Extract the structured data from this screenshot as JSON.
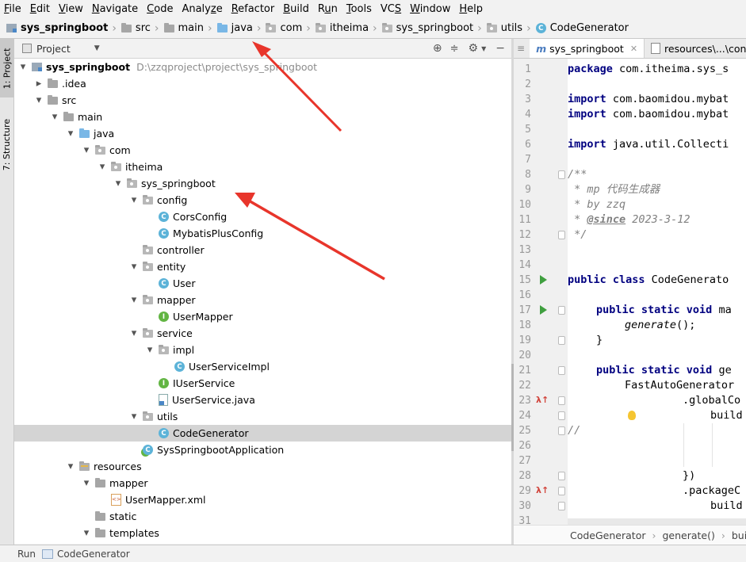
{
  "menubar": [
    "File",
    "Edit",
    "View",
    "Navigate",
    "Code",
    "Analyze",
    "Refactor",
    "Build",
    "Run",
    "Tools",
    "VCS",
    "Window",
    "Help"
  ],
  "menubar_mnemonics": [
    "F",
    "E",
    "V",
    "N",
    "C",
    "z",
    "R",
    "B",
    "u",
    "T",
    "S",
    "W",
    "H"
  ],
  "breadcrumb": [
    "sys_springboot",
    "src",
    "main",
    "java",
    "com",
    "itheima",
    "sys_springboot",
    "utils",
    "CodeGenerator"
  ],
  "left_tool_tabs": [
    "1: Project",
    "7: Structure"
  ],
  "project_panel": {
    "title": "Project"
  },
  "tree": [
    {
      "label": "sys_springboot",
      "path": "D:\\zzqproject\\project\\sys_springboot",
      "depth": 0,
      "arrow": "down",
      "icon": "module-icon",
      "bold": true
    },
    {
      "label": ".idea",
      "depth": 1,
      "arrow": "right",
      "icon": "folder-icon"
    },
    {
      "label": "src",
      "depth": 1,
      "arrow": "down",
      "icon": "folder-icon"
    },
    {
      "label": "main",
      "depth": 2,
      "arrow": "down",
      "icon": "folder-icon"
    },
    {
      "label": "java",
      "depth": 3,
      "arrow": "down",
      "icon": "source-folder-icon"
    },
    {
      "label": "com",
      "depth": 4,
      "arrow": "down",
      "icon": "package-icon"
    },
    {
      "label": "itheima",
      "depth": 5,
      "arrow": "down",
      "icon": "package-icon"
    },
    {
      "label": "sys_springboot",
      "depth": 6,
      "arrow": "down",
      "icon": "package-icon"
    },
    {
      "label": "config",
      "depth": 7,
      "arrow": "down",
      "icon": "package-icon"
    },
    {
      "label": "CorsConfig",
      "depth": 8,
      "arrow": "",
      "icon": "class-icon"
    },
    {
      "label": "MybatisPlusConfig",
      "depth": 8,
      "arrow": "",
      "icon": "class-icon"
    },
    {
      "label": "controller",
      "depth": 7,
      "arrow": "",
      "icon": "package-icon"
    },
    {
      "label": "entity",
      "depth": 7,
      "arrow": "down",
      "icon": "package-icon"
    },
    {
      "label": "User",
      "depth": 8,
      "arrow": "",
      "icon": "class-icon"
    },
    {
      "label": "mapper",
      "depth": 7,
      "arrow": "down",
      "icon": "package-icon"
    },
    {
      "label": "UserMapper",
      "depth": 8,
      "arrow": "",
      "icon": "interface-icon"
    },
    {
      "label": "service",
      "depth": 7,
      "arrow": "down",
      "icon": "package-icon"
    },
    {
      "label": "impl",
      "depth": 8,
      "arrow": "down",
      "icon": "package-icon"
    },
    {
      "label": "UserServiceImpl",
      "depth": 9,
      "arrow": "",
      "icon": "class-icon"
    },
    {
      "label": "IUserService",
      "depth": 8,
      "arrow": "",
      "icon": "interface-icon"
    },
    {
      "label": "UserService.java",
      "depth": 8,
      "arrow": "",
      "icon": "java-file-icon"
    },
    {
      "label": "utils",
      "depth": 7,
      "arrow": "down",
      "icon": "package-icon"
    },
    {
      "label": "CodeGenerator",
      "depth": 8,
      "arrow": "",
      "icon": "class-icon",
      "selected": true
    },
    {
      "label": "SysSpringbootApplication",
      "depth": 7,
      "arrow": "",
      "icon": "spring-class-icon"
    },
    {
      "label": "resources",
      "depth": 3,
      "arrow": "down",
      "icon": "resources-folder-icon"
    },
    {
      "label": "mapper",
      "depth": 4,
      "arrow": "down",
      "icon": "folder-icon"
    },
    {
      "label": "UserMapper.xml",
      "depth": 5,
      "arrow": "",
      "icon": "xml-file-icon"
    },
    {
      "label": "static",
      "depth": 4,
      "arrow": "",
      "icon": "folder-icon"
    },
    {
      "label": "templates",
      "depth": 4,
      "arrow": "down",
      "icon": "folder-icon"
    }
  ],
  "editor_tabs": [
    {
      "label": "sys_springboot",
      "icon": "maven-m-icon",
      "active": true
    },
    {
      "label": "resources\\...\\contr",
      "icon": "file-icon",
      "active": false
    }
  ],
  "line_numbers": [
    "1",
    "2",
    "3",
    "4",
    "5",
    "6",
    "7",
    "8",
    "9",
    "10",
    "11",
    "12",
    "13",
    "14",
    "15",
    "16",
    "17",
    "18",
    "19",
    "20",
    "21",
    "22",
    "23",
    "24",
    "25",
    "26",
    "27",
    "28",
    "29",
    "30",
    "31"
  ],
  "code": {
    "l1_kw": "package",
    "l1_rest": " com.itheima.sys_s",
    "l3_kw": "import",
    "l3_rest": " com.baomidou.mybat",
    "l4_kw": "import",
    "l4_rest": " com.baomidou.mybat",
    "l6_kw": "import",
    "l6_rest": " java.util.Collecti",
    "l8": "/**",
    "l9": " * mp 代码生成器",
    "l10": " * by zzq",
    "l11_pre": " * ",
    "l11_tag": "@since",
    "l11_rest": " 2023-3-12",
    "l12": " */",
    "l15_kw": "public class",
    "l15_rest": " CodeGenerato",
    "l17_kw": "public static void",
    "l17_rest": " ma",
    "l18": "generate",
    "l18_rest": "();",
    "l19": "}",
    "l21_kw": "public static void",
    "l21_rest": " ge",
    "l22": "FastAutoGenerator",
    "l23": ".globalCo",
    "l24": "build",
    "l25": "//",
    "l28": "})",
    "l29": ".packageC",
    "l30": "build"
  },
  "editor_breadcrumb": [
    "CodeGenerator",
    "generate()",
    "bui"
  ],
  "statusbar": {
    "run_label": "Run",
    "run_config": "CodeGenerator"
  }
}
